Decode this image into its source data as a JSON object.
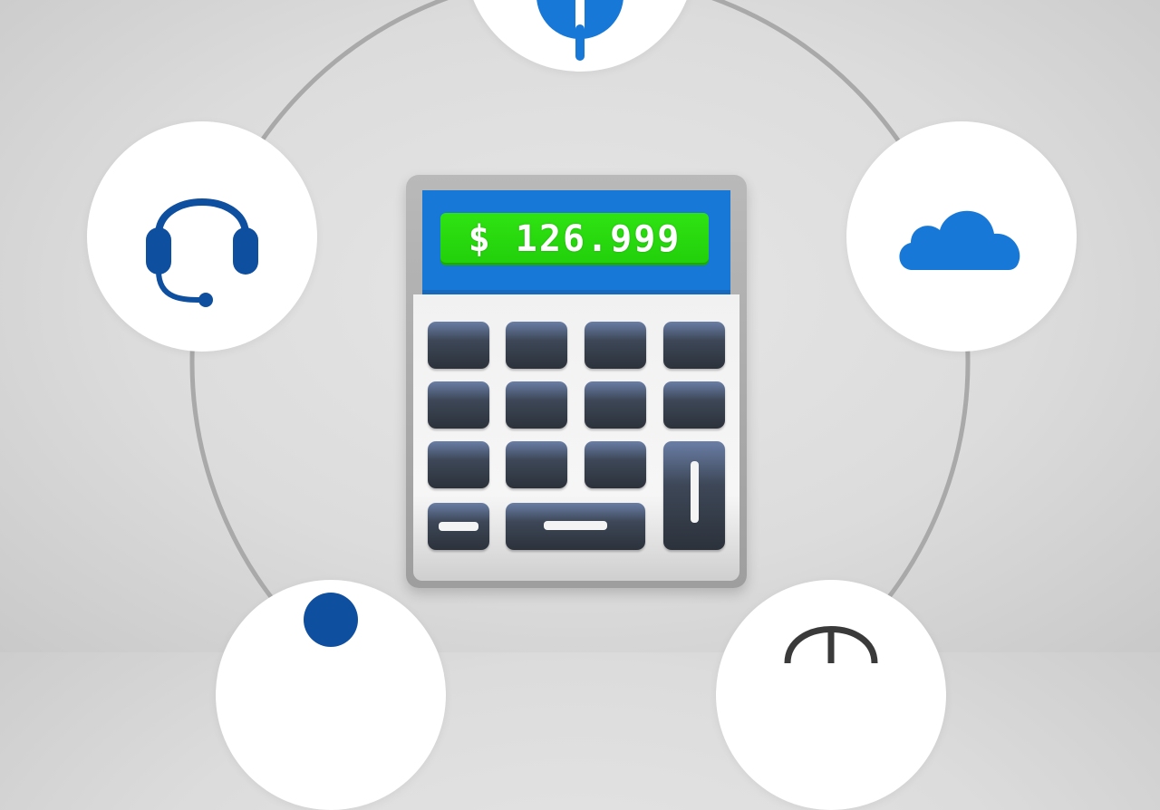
{
  "display": {
    "amount": "$ 126.999"
  },
  "icons": {
    "top": "info-icon",
    "left": "headset-icon",
    "right": "cloud-icon",
    "bottom_left": "person-icon",
    "bottom_right": "globe-icon"
  },
  "colors": {
    "primary_blue": "#1778d8",
    "dark_blue": "#0f4fa0",
    "display_green": "#2fe312",
    "key_dark": "#2c323b",
    "ring_gray": "#a8a8a8"
  }
}
